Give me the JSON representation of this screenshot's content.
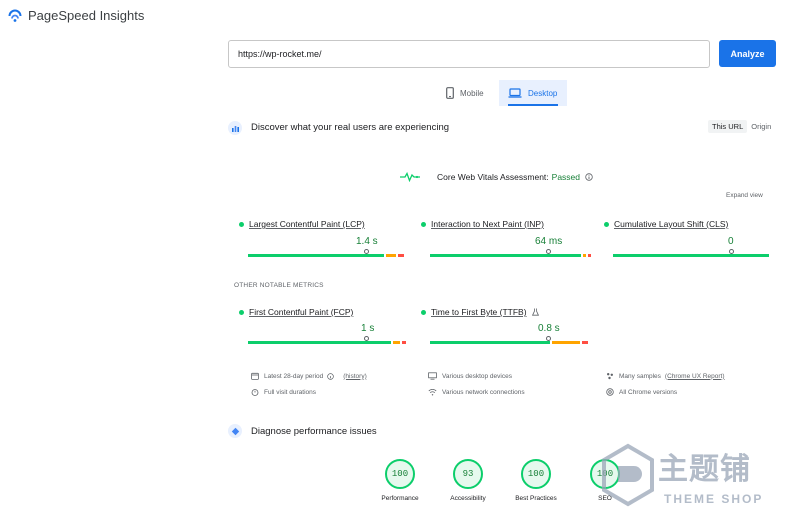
{
  "app": {
    "title": "PageSpeed Insights"
  },
  "search": {
    "value": "https://wp-rocket.me/",
    "button_label": "Analyze"
  },
  "tabs": [
    {
      "label": "Mobile",
      "active": false
    },
    {
      "label": "Desktop",
      "active": true
    }
  ],
  "field": {
    "heading": "Discover what your real users are experiencing",
    "toggle": {
      "this_url": "This URL",
      "origin": "Origin"
    },
    "assessment": {
      "label": "Core Web Vitals Assessment:",
      "status": "Passed"
    },
    "expand_label": "Expand view",
    "core_metrics": [
      {
        "name": "Largest Contentful Paint (LCP)",
        "value": "1.4 s"
      },
      {
        "name": "Interaction to Next Paint (INP)",
        "value": "64 ms"
      },
      {
        "name": "Cumulative Layout Shift (CLS)",
        "value": "0"
      }
    ],
    "other_heading": "OTHER NOTABLE METRICS",
    "other_metrics": [
      {
        "name": "First Contentful Paint (FCP)",
        "value": "1 s"
      },
      {
        "name": "Time to First Byte (TTFB)",
        "value": "0.8 s"
      }
    ],
    "info": {
      "period": "Latest 28-day period",
      "history": "(history)",
      "durations": "Full visit durations",
      "devices": "Various desktop devices",
      "connections": "Various network connections",
      "samples": "Many samples",
      "samples_link": "(Chrome UX Report)",
      "versions": "All Chrome versions"
    }
  },
  "diagnose": {
    "heading": "Diagnose performance issues",
    "scores": [
      {
        "label": "Performance",
        "value": "100"
      },
      {
        "label": "Accessibility",
        "value": "93"
      },
      {
        "label": "Best Practices",
        "value": "100"
      },
      {
        "label": "SEO",
        "value": "100"
      }
    ]
  },
  "watermark": {
    "cn": "主题铺",
    "en": "THEME SHOP"
  },
  "colors": {
    "accent": "#1a73e8",
    "good": "#0cce6b",
    "good_text": "#188038",
    "average": "#ffa400",
    "poor": "#ff4e42"
  }
}
